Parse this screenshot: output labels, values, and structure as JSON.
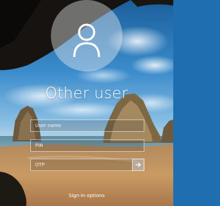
{
  "login": {
    "user_display_name": "Other user",
    "username_placeholder": "User name",
    "pin_placeholder": "PIN",
    "otp_placeholder": "OTP",
    "sign_in_options_label": "Sign-in options"
  },
  "icons": {
    "avatar": "user-silhouette-icon",
    "submit": "arrow-right-icon"
  },
  "colors": {
    "text": "#ffffff",
    "sky": "#1f6fb0",
    "sand": "#c99a63"
  }
}
